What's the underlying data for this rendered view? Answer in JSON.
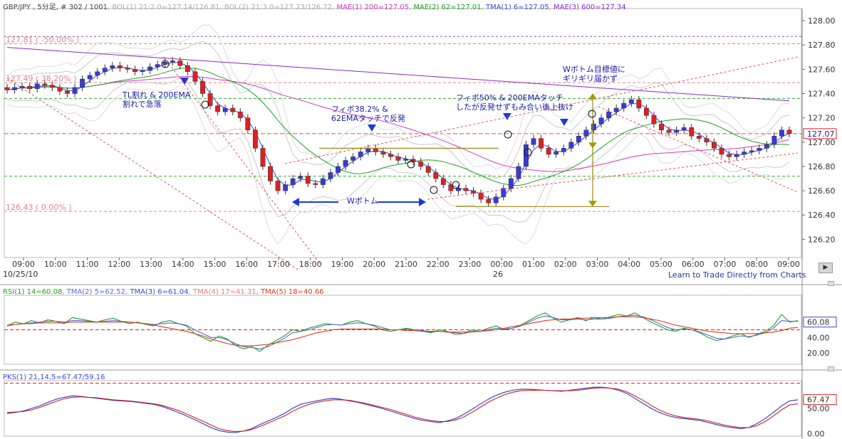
{
  "chart_data": [
    {
      "type": "candlestick",
      "header": {
        "symbol": "GBP/JPY , 5分足, # 302 / 1001",
        "boll1": "BOL(1) 21:2.0=127.14/126.81",
        "boll2": "BOL(2) 21:3.0=127.23/126.72",
        "mae1": "MAE(1) 200=127.05",
        "mae2": "MAE(2) 62=127.01",
        "tma1": "TMA(1) 6=127.05",
        "mae3": "MAE(3) 600=127.34"
      },
      "ylim": [
        126.05,
        128.1
      ],
      "y_ticks": [
        "128.00",
        "127.80",
        "127.60",
        "127.40",
        "127.20",
        "127.00",
        "126.80",
        "126.60",
        "126.40",
        "126.20"
      ],
      "x_ticks": [
        "09:00",
        "10:00",
        "11:00",
        "12:00",
        "13:00",
        "14:00",
        "15:00",
        "16:00",
        "17:00",
        "18:00",
        "19:00",
        "20:00",
        "21:00",
        "22:00",
        "23:00",
        "00:00",
        "01:00",
        "02:00",
        "03:00",
        "04:00",
        "05:00",
        "06:00",
        "07:00",
        "08:00",
        "09:00"
      ],
      "date_label": "10/25/10",
      "day_label": "26",
      "last_price": "127.07",
      "levels": [
        {
          "label": "127.81 ( -50.00% )",
          "value": 127.81,
          "color": "#e8838a"
        },
        {
          "label": "127.49 ( 38.20% )",
          "value": 127.49,
          "color": "#e8838a"
        },
        {
          "label": "126.43 ( 0.00% )",
          "value": 126.43,
          "color": "#e8838a"
        }
      ],
      "closes": [
        127.43,
        127.45,
        127.46,
        127.44,
        127.48,
        127.47,
        127.45,
        127.42,
        127.4,
        127.45,
        127.52,
        127.55,
        127.58,
        127.61,
        127.63,
        127.61,
        127.6,
        127.58,
        127.59,
        127.62,
        127.64,
        127.66,
        127.67,
        127.63,
        127.58,
        127.5,
        127.4,
        127.3,
        127.25,
        127.28,
        127.25,
        127.2,
        127.1,
        126.95,
        126.8,
        126.68,
        126.6,
        126.65,
        126.7,
        126.72,
        126.66,
        126.65,
        126.7,
        126.75,
        126.8,
        126.85,
        126.88,
        126.92,
        126.95,
        126.92,
        126.9,
        126.88,
        126.85,
        126.86,
        126.84,
        126.8,
        126.75,
        126.7,
        126.65,
        126.6,
        126.62,
        126.6,
        126.58,
        126.53,
        126.5,
        126.55,
        126.62,
        126.7,
        126.8,
        126.98,
        127.03,
        126.95,
        126.9,
        126.92,
        126.95,
        127.0,
        127.05,
        127.1,
        127.15,
        127.2,
        127.25,
        127.28,
        127.32,
        127.35,
        127.28,
        127.22,
        127.15,
        127.1,
        127.08,
        127.1,
        127.12,
        127.05,
        127.03,
        127.0,
        126.95,
        126.9,
        126.88,
        126.9,
        126.92,
        126.93,
        126.95,
        126.98,
        127.05,
        127.1,
        127.07
      ],
      "annotations": [
        {
          "text": "TL割れ & 200EMA\n割れで急落"
        },
        {
          "text": "フィボ38.2% &\n62EMAタッチで反発"
        },
        {
          "text": "Wボトム"
        },
        {
          "text": "フィボ50% & 200EMAタッチ\nしたが反発せずもみ合い後上抜け"
        },
        {
          "text": "Wボトム目標値に\nギリギリ届かず"
        }
      ],
      "footer_link": "Learn to Trade Directly from Charts"
    },
    {
      "type": "line",
      "header": {
        "rsi": "RSI(1) 14=60.08",
        "tma2": "TMA(2) 5=62.52",
        "tma3": "TMA(3) 6=61.04",
        "tma4": "TMA(4) 17=41.31",
        "tma5": "TMA(5) 18=40.66"
      },
      "ylim": [
        5,
        95
      ],
      "y_ticks": [
        "60.08",
        "40.00",
        "20.00"
      ],
      "reference_line": 50,
      "series": [
        {
          "name": "RSI(1) 14",
          "color": "#20a020",
          "values": [
            55,
            60,
            58,
            62,
            59,
            63,
            61,
            58,
            66,
            64,
            62,
            60,
            63,
            65,
            61,
            58,
            60,
            57,
            55,
            60,
            62,
            58,
            55,
            45,
            40,
            35,
            42,
            38,
            30,
            25,
            28,
            22,
            30,
            36,
            42,
            50,
            48,
            52,
            55,
            58,
            57,
            56,
            60,
            62,
            58,
            55,
            50,
            48,
            50,
            52,
            50,
            48,
            46,
            50,
            48,
            44,
            45,
            50,
            48,
            52,
            55,
            50,
            52,
            56,
            62,
            68,
            72,
            65,
            60,
            63,
            66,
            62,
            66,
            64,
            67,
            70,
            68,
            72,
            66,
            60,
            55,
            50,
            48,
            52,
            50,
            46,
            40,
            36,
            38,
            42,
            45,
            40,
            44,
            48,
            55,
            70,
            60,
            62
          ]
        },
        {
          "name": "TMA(2) 5",
          "color": "#5a6ad8",
          "values": [
            55,
            57,
            58,
            59,
            60,
            61,
            61,
            60,
            62,
            62,
            61,
            60,
            61,
            62,
            61,
            60,
            59,
            58,
            57,
            58,
            59,
            58,
            56,
            50,
            45,
            40,
            40,
            37,
            32,
            28,
            27,
            25,
            28,
            33,
            39,
            46,
            48,
            50,
            53,
            56,
            57,
            56,
            58,
            59,
            58,
            56,
            53,
            50,
            50,
            51,
            50,
            49,
            47,
            48,
            47,
            46,
            45,
            48,
            48,
            50,
            52,
            51,
            52,
            55,
            60,
            65,
            68,
            66,
            63,
            63,
            64,
            63,
            64,
            64,
            65,
            67,
            68,
            69,
            67,
            63,
            58,
            53,
            50,
            51,
            50,
            47,
            43,
            39,
            38,
            40,
            42,
            41,
            43,
            46,
            52,
            62,
            61,
            61
          ]
        },
        {
          "name": "TMA(5) 18",
          "color": "#e03a1a",
          "values": [
            56,
            57,
            58,
            58,
            59,
            59,
            59,
            59,
            60,
            60,
            60,
            60,
            60,
            60,
            60,
            60,
            59,
            58,
            56,
            54,
            52,
            50,
            48,
            45,
            42,
            38,
            35,
            32,
            30,
            29,
            29,
            30,
            31,
            33,
            35,
            37,
            40,
            43,
            46,
            48,
            50,
            51,
            51,
            51,
            51,
            51,
            51,
            50,
            50,
            49,
            49,
            48,
            48,
            48,
            47,
            47,
            47,
            47,
            48,
            49,
            50,
            52,
            54,
            56,
            58,
            60,
            62,
            63,
            64,
            64,
            65,
            65,
            66,
            66,
            66,
            67,
            67,
            67,
            66,
            64,
            62,
            59,
            56,
            54,
            52,
            50,
            48,
            47,
            46,
            45,
            45,
            45,
            45,
            46,
            47,
            49,
            52,
            53
          ]
        }
      ]
    },
    {
      "type": "line",
      "header": {
        "pks": "PKS(1) 21,14,5=67.47/59.16"
      },
      "ylim": [
        -5,
        105
      ],
      "y_ticks": [
        "67.47",
        "50.00",
        "0.00"
      ],
      "reference_line": 100,
      "series": [
        {
          "name": "PKS %K",
          "color": "#2a3ad0",
          "values": [
            40,
            42,
            45,
            50,
            55,
            62,
            68,
            72,
            75,
            74,
            72,
            70,
            68,
            66,
            65,
            64,
            62,
            60,
            58,
            54,
            48,
            42,
            35,
            28,
            20,
            12,
            6,
            3,
            2,
            5,
            10,
            18,
            25,
            32,
            40,
            50,
            58,
            62,
            65,
            68,
            70,
            68,
            65,
            62,
            58,
            54,
            50,
            45,
            40,
            35,
            30,
            26,
            24,
            22,
            25,
            30,
            38,
            48,
            58,
            68,
            76,
            82,
            86,
            88,
            88,
            87,
            86,
            85,
            84,
            86,
            88,
            90,
            92,
            92,
            90,
            86,
            80,
            70,
            60,
            50,
            42,
            36,
            32,
            30,
            28,
            26,
            22,
            18,
            14,
            12,
            10,
            12,
            20,
            30,
            42,
            55,
            65,
            67
          ]
        },
        {
          "name": "PKS %D",
          "color": "#d02020",
          "values": [
            42,
            43,
            44,
            47,
            52,
            58,
            64,
            69,
            72,
            73,
            72,
            71,
            69,
            67,
            66,
            65,
            63,
            61,
            59,
            56,
            51,
            46,
            39,
            32,
            25,
            17,
            10,
            6,
            4,
            5,
            8,
            14,
            21,
            28,
            35,
            44,
            52,
            58,
            62,
            65,
            67,
            67,
            66,
            63,
            60,
            56,
            52,
            48,
            43,
            38,
            33,
            29,
            26,
            24,
            24,
            27,
            33,
            42,
            52,
            62,
            70,
            77,
            82,
            85,
            86,
            86,
            86,
            85,
            85,
            85,
            86,
            88,
            90,
            91,
            90,
            88,
            83,
            75,
            66,
            56,
            47,
            40,
            35,
            32,
            30,
            28,
            25,
            21,
            17,
            14,
            12,
            12,
            16,
            24,
            35,
            47,
            57,
            59
          ]
        }
      ]
    }
  ],
  "ui": {
    "scroll_glyph": "▶"
  }
}
